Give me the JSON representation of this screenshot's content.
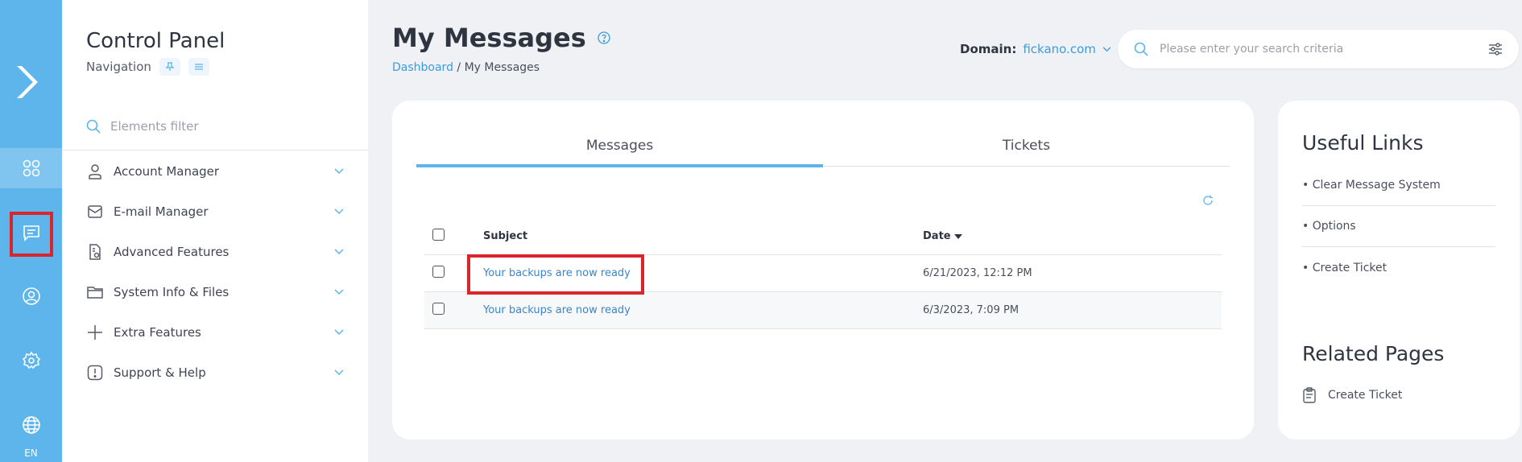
{
  "rail": {
    "items": [
      {
        "icon": "dashboard-grid-icon"
      },
      {
        "icon": "messages-icon"
      },
      {
        "icon": "user-circle-icon"
      },
      {
        "icon": "settings-gear-icon"
      },
      {
        "icon": "globe-icon"
      }
    ],
    "language": "EN"
  },
  "nav": {
    "title": "Control Panel",
    "subtitle": "Navigation",
    "filter_placeholder": "Elements filter",
    "items": [
      {
        "label": "Account Manager",
        "icon": "user-icon"
      },
      {
        "label": "E-mail Manager",
        "icon": "envelope-icon"
      },
      {
        "label": "Advanced Features",
        "icon": "document-settings-icon"
      },
      {
        "label": "System Info & Files",
        "icon": "folder-icon"
      },
      {
        "label": "Extra Features",
        "icon": "plus-icon"
      },
      {
        "label": "Support & Help",
        "icon": "alert-icon"
      }
    ]
  },
  "header": {
    "title": "My Messages",
    "breadcrumb_link": "Dashboard",
    "breadcrumb_sep": " / ",
    "breadcrumb_current": "My Messages",
    "domain_label": "Domain:",
    "domain_value": "fickano.com",
    "search_placeholder": "Please enter your search criteria"
  },
  "main": {
    "tabs": [
      {
        "label": "Messages",
        "active": true
      },
      {
        "label": "Tickets",
        "active": false
      }
    ],
    "columns": {
      "subject": "Subject",
      "date": "Date"
    },
    "rows": [
      {
        "subject": "Your backups are now ready",
        "date": "6/21/2023, 12:12 PM"
      },
      {
        "subject": "Your backups are now ready",
        "date": "6/3/2023, 7:09 PM"
      }
    ]
  },
  "sidebar_right": {
    "useful_title": "Useful Links",
    "links": [
      "• Clear Message System",
      "• Options",
      "• Create Ticket"
    ],
    "related_title": "Related Pages",
    "related": [
      {
        "label": "Create Ticket",
        "icon": "clipboard-icon"
      }
    ]
  },
  "colors": {
    "rail": "#5db5ec",
    "link": "#3c9bdc",
    "highlight": "#d9262c",
    "background": "#f0f1f5"
  }
}
